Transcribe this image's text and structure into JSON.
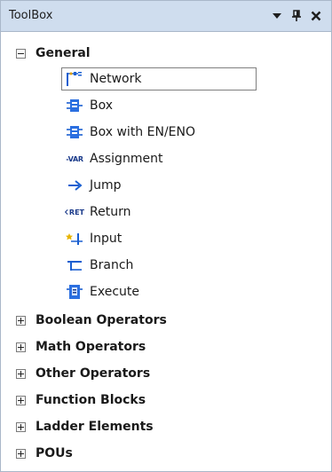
{
  "panel": {
    "title": "ToolBox"
  },
  "tree": {
    "general": {
      "label": "General",
      "items": [
        {
          "label": "Network",
          "icon": "network-icon"
        },
        {
          "label": "Box",
          "icon": "box-icon"
        },
        {
          "label": "Box with EN/ENO",
          "icon": "box-en-eno-icon"
        },
        {
          "label": "Assignment",
          "icon": "assignment-icon",
          "icon_text": "-VAR"
        },
        {
          "label": "Jump",
          "icon": "jump-icon"
        },
        {
          "label": "Return",
          "icon": "return-icon",
          "icon_text": "RET"
        },
        {
          "label": "Input",
          "icon": "input-icon"
        },
        {
          "label": "Branch",
          "icon": "branch-icon"
        },
        {
          "label": "Execute",
          "icon": "execute-icon"
        }
      ]
    },
    "categories": [
      {
        "label": "Boolean Operators"
      },
      {
        "label": "Math Operators"
      },
      {
        "label": "Other Operators"
      },
      {
        "label": "Function Blocks"
      },
      {
        "label": "Ladder Elements"
      },
      {
        "label": "POUs"
      }
    ]
  },
  "colors": {
    "title_bar": "#cfddee",
    "icon_blue": "#1a5fd0",
    "border": "#a9b7c9"
  }
}
